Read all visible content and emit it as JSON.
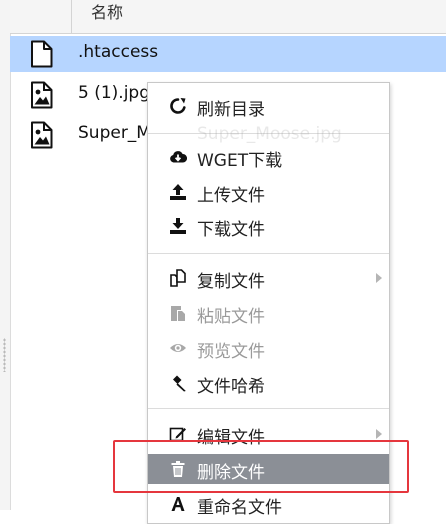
{
  "header": {
    "name_column": "名称"
  },
  "files": [
    {
      "name": ".htaccess",
      "icon": "file-icon",
      "selected": true
    },
    {
      "name": "5 (1).jpg",
      "icon": "image-file-icon",
      "selected": false
    },
    {
      "name": "Super_Moose.jpg",
      "icon": "image-file-icon",
      "selected": false
    }
  ],
  "context_menu": {
    "refresh": "刷新目录",
    "wget": "WGET下载",
    "upload": "上传文件",
    "download": "下载文件",
    "copy": "复制文件",
    "paste": "粘贴文件",
    "preview": "预览文件",
    "hash": "文件哈希",
    "edit": "编辑文件",
    "delete": "删除文件",
    "rename": "重命名文件"
  },
  "ghost_text": "Super_Moose.jpg",
  "colors": {
    "selected_row": "#b6d5ff",
    "active_menu_item": "#8b8f96",
    "highlight_border": "#e5363d"
  }
}
